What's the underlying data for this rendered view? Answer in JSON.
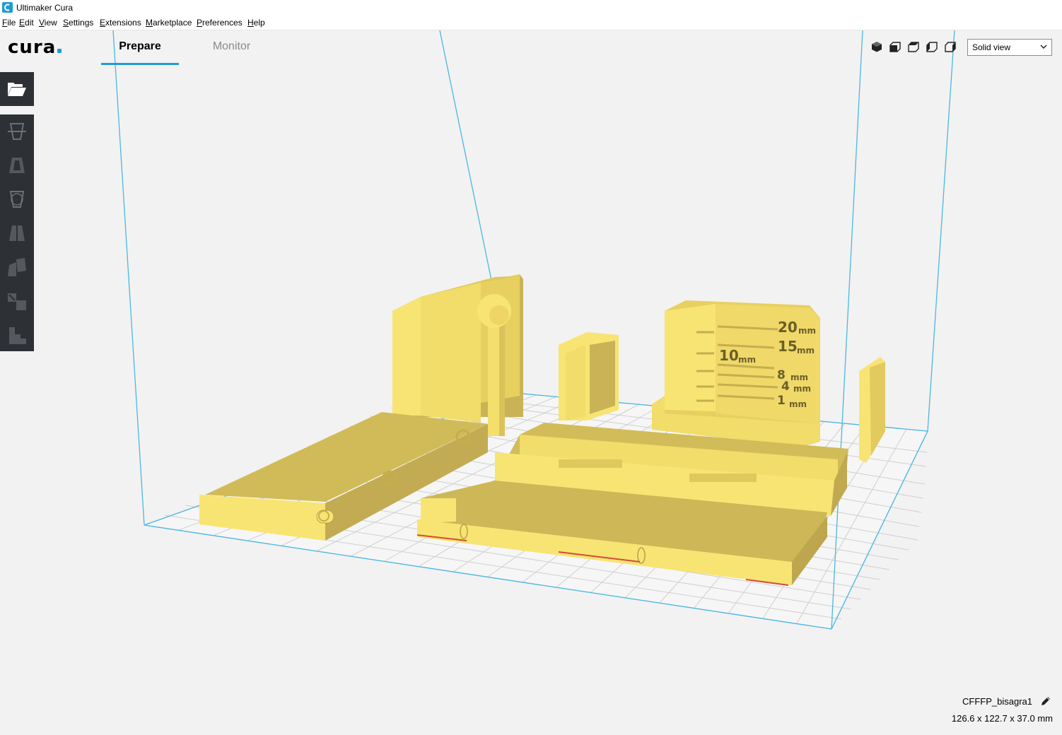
{
  "window": {
    "title": "Ultimaker Cura"
  },
  "menu": [
    "File",
    "Edit",
    "View",
    "Settings",
    "Extensions",
    "Marketplace",
    "Preferences",
    "Help"
  ],
  "header": {
    "logo": "cura",
    "tabs": [
      {
        "label": "Prepare",
        "active": true
      },
      {
        "label": "Monitor",
        "active": false
      }
    ]
  },
  "view": {
    "buttons": [
      "3d-view-icon",
      "front-view-icon",
      "top-view-icon",
      "left-view-icon",
      "right-view-icon"
    ],
    "mode": "Solid view"
  },
  "toolbar": {
    "open": "folder-open-icon",
    "tools": [
      "move-tool-icon",
      "scale-tool-icon",
      "rotate-tool-icon",
      "mirror-tool-icon",
      "per-model-settings-icon",
      "support-blocker-icon",
      "layflat-icon"
    ]
  },
  "scene": {
    "model_labels": [
      "20",
      "mm",
      "15",
      "mm",
      "10",
      "mm",
      "8",
      "mm",
      "4",
      "mm",
      "1",
      "mm"
    ]
  },
  "object": {
    "name": "CFFFP_bisagra1",
    "dimensions": "126.6 x 122.7 x 37.0 mm"
  },
  "colors": {
    "accent": "#1f9bd6",
    "model": "#f8e473",
    "model_shadow": "#c9b356",
    "toolbar": "#2d3035"
  }
}
